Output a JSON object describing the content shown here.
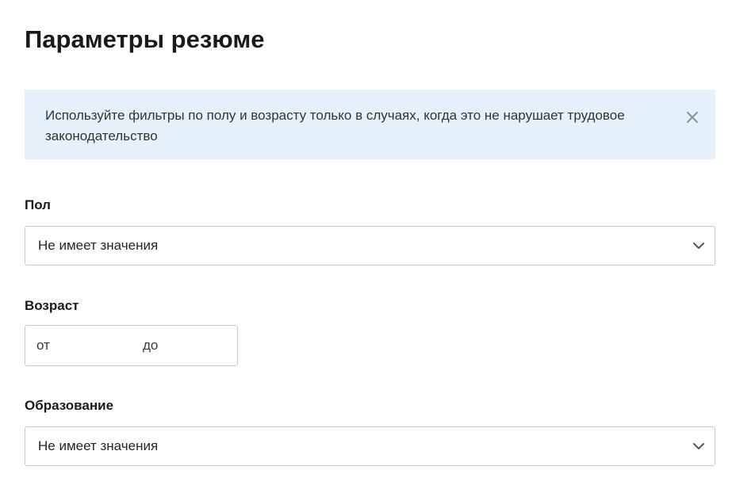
{
  "page": {
    "title": "Параметры резюме"
  },
  "notice": {
    "text": "Используйте фильтры по полу и возрасту только в случаях, когда это не нарушает трудовое законодательство",
    "close_icon": "close-icon"
  },
  "fields": {
    "gender": {
      "label": "Пол",
      "value": "Не имеет значения"
    },
    "age": {
      "label": "Возраст",
      "from_placeholder": "от",
      "to_placeholder": "до"
    },
    "education": {
      "label": "Образование",
      "value": "Не имеет значения"
    }
  },
  "colors": {
    "notice_background": "#e6f0fa",
    "border": "#c9c9c9"
  }
}
